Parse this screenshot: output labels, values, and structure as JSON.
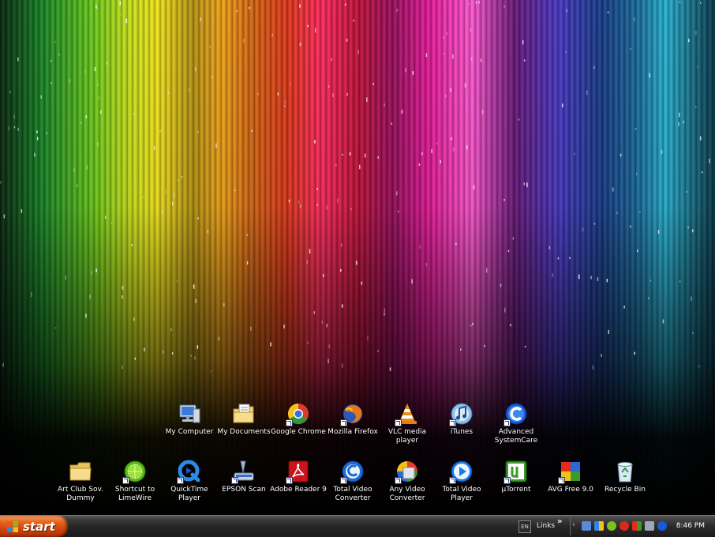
{
  "desktop": {
    "icons_row1": [
      {
        "label": "My Computer",
        "icon": "computer-icon",
        "shortcut": false
      },
      {
        "label": "My Documents",
        "icon": "folder-documents-icon",
        "shortcut": false
      },
      {
        "label": "Google Chrome",
        "icon": "chrome-icon",
        "shortcut": true
      },
      {
        "label": "Mozilla Firefox",
        "icon": "firefox-icon",
        "shortcut": true
      },
      {
        "label": "VLC media player",
        "icon": "vlc-icon",
        "shortcut": true
      },
      {
        "label": "iTunes",
        "icon": "itunes-icon",
        "shortcut": true
      },
      {
        "label": "Advanced SystemCare",
        "icon": "systemcare-icon",
        "shortcut": true
      }
    ],
    "icons_row2": [
      {
        "label": "Art Club Sov. Dummy",
        "icon": "folder-icon",
        "shortcut": false
      },
      {
        "label": "Shortcut to LimeWire",
        "icon": "limewire-icon",
        "shortcut": true
      },
      {
        "label": "QuickTime Player",
        "icon": "quicktime-icon",
        "shortcut": true
      },
      {
        "label": "EPSON Scan",
        "icon": "scanner-icon",
        "shortcut": true
      },
      {
        "label": "Adobe Reader 9",
        "icon": "adobe-reader-icon",
        "shortcut": true
      },
      {
        "label": "Total Video Converter",
        "icon": "video-converter-icon",
        "shortcut": true
      },
      {
        "label": "Any Video Converter",
        "icon": "any-video-converter-icon",
        "shortcut": true
      },
      {
        "label": "Total Video Player",
        "icon": "video-player-icon",
        "shortcut": true
      },
      {
        "label": "µTorrent",
        "icon": "utorrent-icon",
        "shortcut": true
      },
      {
        "label": "AVG Free 9.0",
        "icon": "avg-icon",
        "shortcut": true
      },
      {
        "label": "Recycle Bin",
        "icon": "recycle-bin-icon",
        "shortcut": false
      }
    ]
  },
  "taskbar": {
    "start_label": "start",
    "language": "EN",
    "links_label": "Links",
    "links_chevron": "»",
    "tray_expand": "‹",
    "tray_icons": [
      "network-icon",
      "windows-update-icon",
      "messenger-icon",
      "security-center-icon",
      "audio-icon",
      "tools-icon",
      "systemcare-tray-icon"
    ],
    "clock": "8:46 PM"
  },
  "colors": {
    "taskbar": "#262626",
    "start_button": "#e8641c",
    "text": "#ffffff"
  }
}
